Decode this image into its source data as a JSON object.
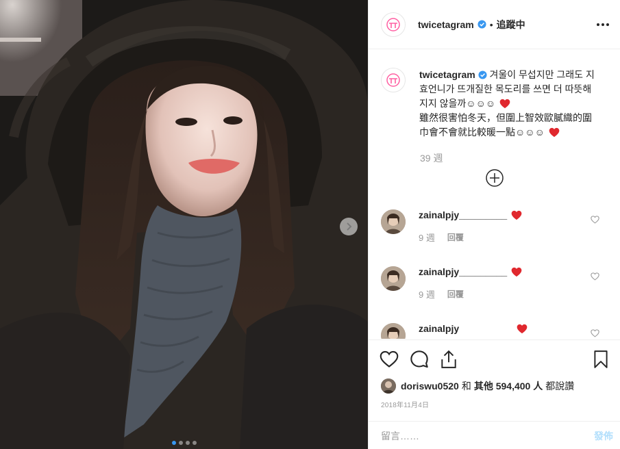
{
  "header": {
    "username": "twicetagram",
    "separator": "•",
    "follow_label": "追蹤中"
  },
  "caption": {
    "username": "twicetagram",
    "text": "겨울이 무섭지만 그래도 지효언니가 뜨개질한 목도리를 쓰면 더 따뜻해지지 않을까☺☺☺",
    "text2": "雖然很害怕冬天，但圍上智效歐膩織的圍巾會不會就比較暖一點☺☺☺",
    "time": "39 週"
  },
  "comments": [
    {
      "username": "zainalpjy_________",
      "time": "9 週",
      "reply_label": "回覆"
    },
    {
      "username": "zainalpjy_________",
      "time": "9 週",
      "reply_label": "回覆"
    },
    {
      "username": "zainalpjy"
    }
  ],
  "likes": {
    "user": "doriswu0520",
    "and": "和",
    "others": "其他 594,400 人",
    "liked": "都說讚"
  },
  "date": "2018年11月4日",
  "comment_input": {
    "placeholder": "留言……"
  },
  "post_label": "發佈",
  "carousel": {
    "count": 4,
    "active": 1
  },
  "colors": {
    "accent": "#3897f0",
    "heart": "#ed4956",
    "brand": "#ff5fa2"
  },
  "icons": [
    "twice-logo-icon",
    "verified-icon",
    "more-options-icon",
    "load-more-icon",
    "heart-icon",
    "comment-icon",
    "share-icon",
    "bookmark-icon",
    "next-arrow-icon"
  ]
}
